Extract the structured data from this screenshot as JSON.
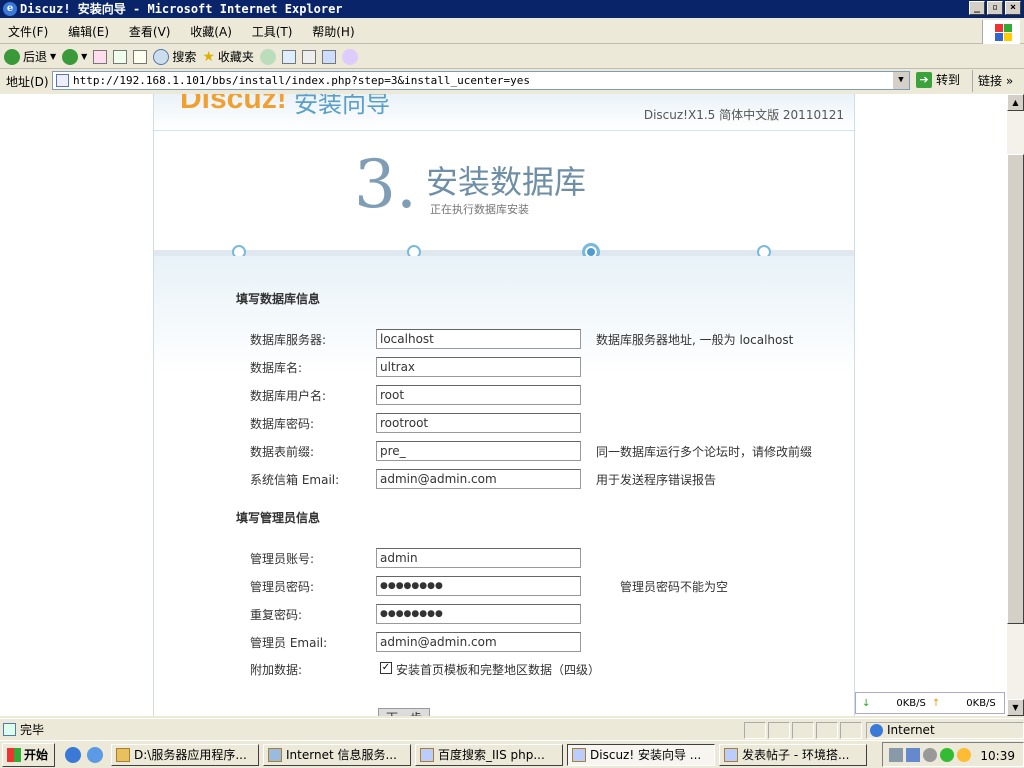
{
  "window": {
    "title": "Discuz! 安装向导 - Microsoft Internet Explorer",
    "btn_min": "_",
    "btn_max": "▫",
    "btn_close": "×"
  },
  "menu": [
    "文件(F)",
    "编辑(E)",
    "查看(V)",
    "收藏(A)",
    "工具(T)",
    "帮助(H)"
  ],
  "toolbar": {
    "back": "后退",
    "search": "搜索",
    "favorites": "收藏夹"
  },
  "address": {
    "label": "地址(D)",
    "url": "http://192.168.1.101/bbs/install/index.php?step=3&install_ucenter=yes",
    "go": "转到",
    "links": "链接"
  },
  "page": {
    "logo": "Discuz!",
    "logo_cn": "安装向导",
    "version": "Discuz!X1.5 简体中文版 20110121",
    "step_number": "3.",
    "step_title": "安装数据库",
    "step_subtitle": "正在执行数据库安装",
    "steps_total": 4,
    "step_current": 3,
    "db_section": "填写数据库信息",
    "db_fields": [
      {
        "label": "数据库服务器:",
        "value": "localhost",
        "hint": "数据库服务器地址, 一般为 localhost"
      },
      {
        "label": "数据库名:",
        "value": "ultrax",
        "hint": ""
      },
      {
        "label": "数据库用户名:",
        "value": "root",
        "hint": ""
      },
      {
        "label": "数据库密码:",
        "value": "rootroot",
        "hint": ""
      },
      {
        "label": "数据表前缀:",
        "value": "pre_",
        "hint": "同一数据库运行多个论坛时，请修改前缀"
      },
      {
        "label": "系统信箱 Email:",
        "value": "admin@admin.com",
        "hint": "用于发送程序错误报告"
      }
    ],
    "admin_section": "填写管理员信息",
    "admin_fields": [
      {
        "label": "管理员账号:",
        "value": "admin",
        "hint": ""
      },
      {
        "label": "管理员密码:",
        "value": "●●●●●●●●",
        "hint": "管理员密码不能为空"
      },
      {
        "label": "重复密码:",
        "value": "●●●●●●●●",
        "hint": ""
      },
      {
        "label": "管理员 Email:",
        "value": "admin@admin.com",
        "hint": ""
      }
    ],
    "extra_label": "附加数据:",
    "extra_checkbox": "安装首页模板和完整地区数据（四级）",
    "extra_checked": true,
    "next_button": "下一步"
  },
  "netmon": {
    "down": "0KB/S",
    "up": "0KB/S"
  },
  "status": {
    "text": "完毕",
    "zone": "Internet"
  },
  "taskbar": {
    "start": "开始",
    "tasks": [
      "D:\\服务器应用程序...",
      "Internet 信息服务...",
      "百度搜索_IIS php...",
      "Discuz! 安装向导 ...",
      "发表帖子 - 环境搭..."
    ],
    "active_index": 3,
    "clock": "10:39"
  }
}
